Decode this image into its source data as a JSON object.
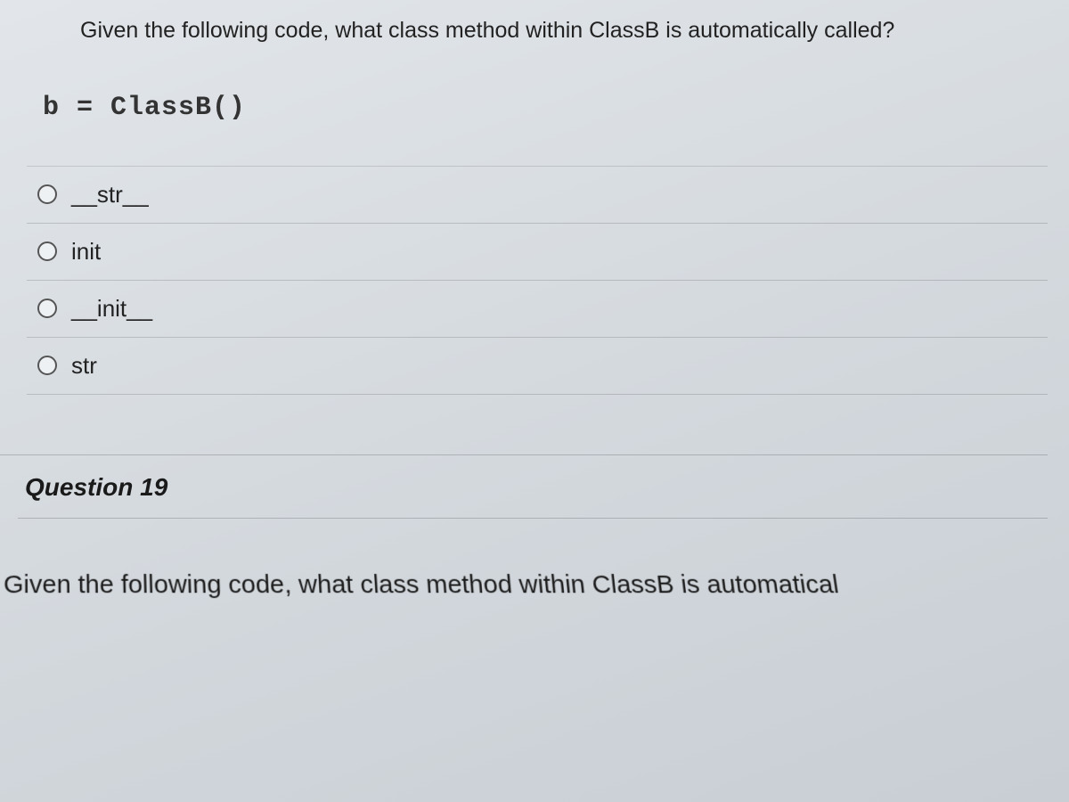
{
  "question": {
    "prompt": "Given the following code, what class method within ClassB is automatically called?",
    "code": "b = ClassB()",
    "options": [
      {
        "label": "__str__"
      },
      {
        "label": "init"
      },
      {
        "label": "__init__"
      },
      {
        "label": "str"
      }
    ]
  },
  "next_question": {
    "header": "Question 19",
    "prompt_partial": "Given the following code, what class method within ClassB is automatical"
  }
}
